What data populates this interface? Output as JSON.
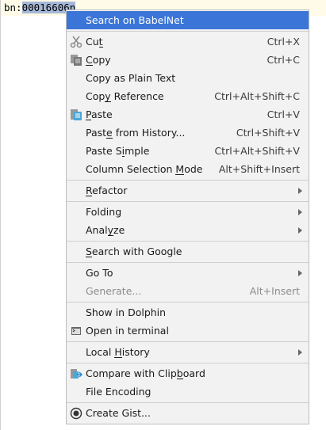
{
  "editor": {
    "prefix": "bn:",
    "selected": "00016606n"
  },
  "menu": [
    {
      "label": "Search on BabelNet",
      "highlighted": true
    },
    {
      "sep": true
    },
    {
      "label": "Cut",
      "mn": 2,
      "shortcut": "Ctrl+X",
      "icon": "scissors-icon"
    },
    {
      "label": "Copy",
      "mn": 0,
      "shortcut": "Ctrl+C",
      "icon": "copy-icon"
    },
    {
      "label": "Copy as Plain Text"
    },
    {
      "label": "Copy Reference",
      "mn": 3,
      "shortcut": "Ctrl+Alt+Shift+C"
    },
    {
      "label": "Paste",
      "mn": 0,
      "shortcut": "Ctrl+V",
      "icon": "paste-icon"
    },
    {
      "label": "Paste from History...",
      "mn": 4,
      "shortcut": "Ctrl+Shift+V"
    },
    {
      "label": "Paste Simple",
      "mn": 7,
      "shortcut": "Ctrl+Alt+Shift+V"
    },
    {
      "label": "Column Selection Mode",
      "mn": 17,
      "shortcut": "Alt+Shift+Insert"
    },
    {
      "sep": true
    },
    {
      "label": "Refactor",
      "mn": 0,
      "submenu": true
    },
    {
      "sep": true
    },
    {
      "label": "Folding",
      "submenu": true
    },
    {
      "label": "Analyze",
      "mn": 4,
      "submenu": true
    },
    {
      "sep": true
    },
    {
      "label": "Search with Google",
      "mn": 0
    },
    {
      "sep": true
    },
    {
      "label": "Go To",
      "submenu": true
    },
    {
      "label": "Generate...",
      "shortcut": "Alt+Insert",
      "disabled": true
    },
    {
      "sep": true
    },
    {
      "label": "Show in Dolphin"
    },
    {
      "label": "Open in terminal",
      "icon": "terminal-icon"
    },
    {
      "sep": true
    },
    {
      "label": "Local History",
      "mn": 6,
      "submenu": true
    },
    {
      "sep": true
    },
    {
      "label": "Compare with Clipboard",
      "mn": 17,
      "icon": "compare-icon"
    },
    {
      "label": "File Encoding"
    },
    {
      "sep": true
    },
    {
      "label": "Create Gist...",
      "icon": "github-icon"
    }
  ]
}
